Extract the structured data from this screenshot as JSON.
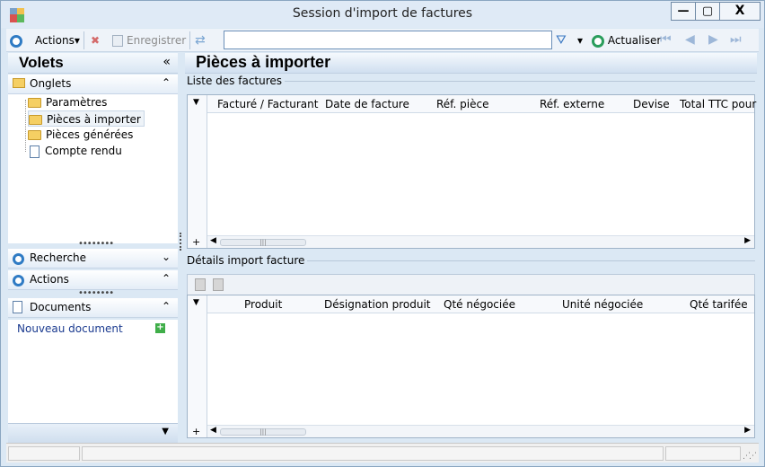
{
  "window": {
    "title": "Session d'import de factures",
    "min_glyph": "—",
    "max_glyph": "▢",
    "close_glyph": "X"
  },
  "toolbar": {
    "actions_label": "Actions",
    "save_label": "Enregistrer",
    "search_value": "",
    "refresh_label": "Actualiser",
    "dropdown_glyph": "▾",
    "filter_glyph": "⛛",
    "delete_glyph": "✖",
    "nav_glyphs": [
      "⏮",
      "◀",
      "▶",
      "⏭"
    ]
  },
  "left_panel": {
    "title": "Volets",
    "collapse_glyph": "«",
    "sections": {
      "onglets": "Onglets",
      "recherche": "Recherche",
      "actions": "Actions",
      "documents": "Documents"
    },
    "chevron_up": "⌃",
    "chevron_down": "⌄",
    "tree": [
      {
        "label": "Paramètres"
      },
      {
        "label": "Pièces à importer"
      },
      {
        "label": "Pièces générées"
      },
      {
        "label": "Compte rendu"
      }
    ],
    "documents_link": "Nouveau document",
    "plus_glyph": "+",
    "grip_glyph": "••••••••",
    "footer_chevron": "▼"
  },
  "main": {
    "title": "Pièces à importer",
    "invoices_group": "Liste des factures",
    "invoices_columns": [
      "Facturé / Facturant",
      "Date de facture",
      "Réf. pièce",
      "Réf. externe",
      "Devise",
      "Total TTC pour"
    ],
    "details_group": "Détails import facture",
    "details_columns": [
      "Produit",
      "Désignation produit",
      "Qté négociée",
      "Unité négociée",
      "Qté tarifée"
    ],
    "row_dropdown_glyph": "▼",
    "plus_glyph": "+",
    "scroll_left_glyph": "◀",
    "scroll_right_glyph": "▶",
    "scroll_thumb_glyph": "|||"
  },
  "status": {
    "grip_glyph": "⋰⋰"
  }
}
